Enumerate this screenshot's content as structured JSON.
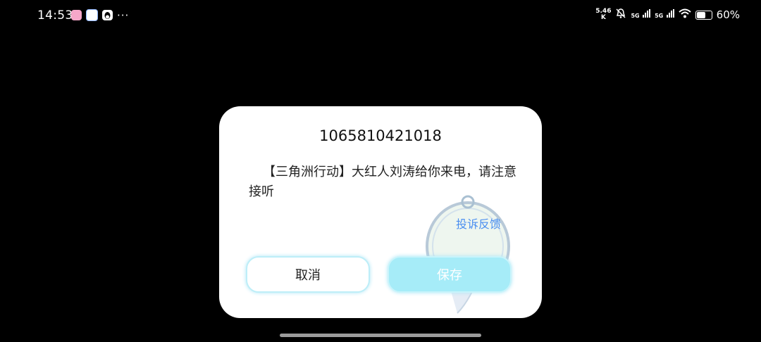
{
  "status_bar": {
    "time": "14:53",
    "notification_icons": [
      "pink-app-icon",
      "blue-app-icon",
      "qq-penguin-icon"
    ],
    "more_dots": "···",
    "network_speed_value": "5.46",
    "network_speed_unit": "K",
    "icons": [
      "silent-bell-icon",
      "5g-signal-icon",
      "5g-signal-icon",
      "wifi-icon",
      "battery-icon"
    ],
    "net_label_1": "5G",
    "net_label_2": "5G",
    "battery_level": 0.6,
    "battery_text": "60%"
  },
  "dialog": {
    "sender": "1065810421018",
    "message": "【三角洲行动】大红人刘涛给你来电，请注意接听",
    "feedback_link": "投诉反馈",
    "cancel_label": "取消",
    "save_label": "保存",
    "accent_color": "#a6ecf8",
    "link_color": "#4a8ef0"
  }
}
